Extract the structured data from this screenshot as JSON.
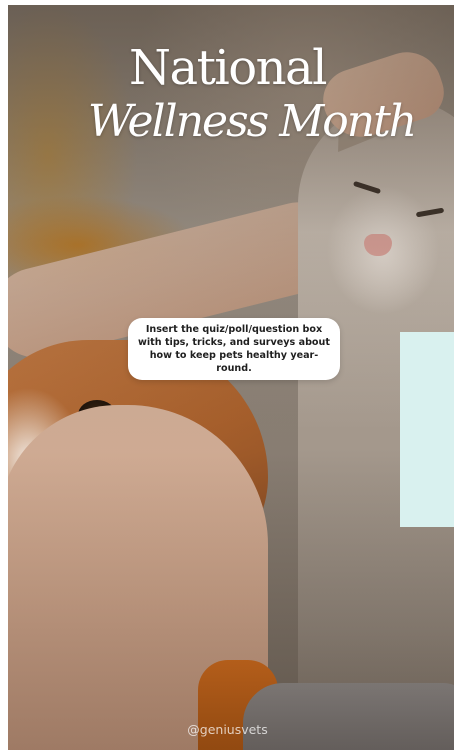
{
  "story": {
    "title_line1": "National",
    "title_line2": "Wellness Month",
    "prompt_box_text": "Insert the quiz/poll/question box with tips, tricks, and surveys about how to keep pets healthy year-round.",
    "handle": "@geniusvets"
  },
  "colors": {
    "side_panel": "#d9f1ef",
    "title_text": "#ffffff",
    "prompt_box_bg": "#ffffff"
  },
  "icons": []
}
